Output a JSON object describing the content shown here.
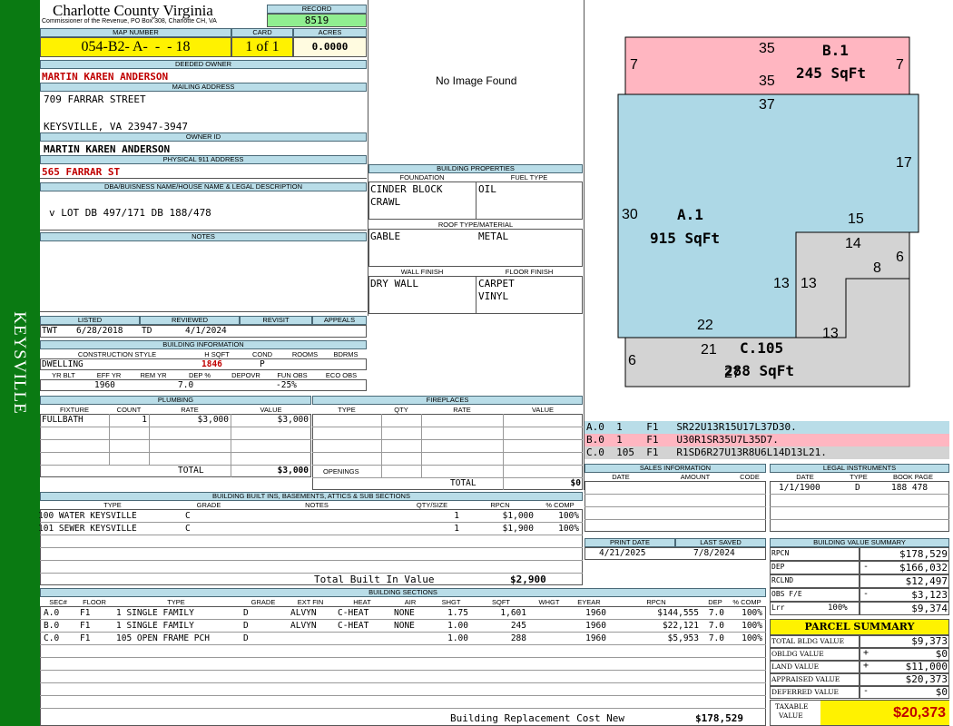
{
  "sidebar": {
    "label": "KEYSVILLE"
  },
  "county": {
    "title": "Charlotte County Virginia",
    "subtitle": "Commissioner of the Revenue, PO Box 308, Charlotte CH, VA"
  },
  "record": {
    "label": "RECORD",
    "value": "8519"
  },
  "map": {
    "label": "MAP NUMBER",
    "value": "054-B2- A-  -  - 18",
    "card_label": "CARD",
    "card": "1 of 1",
    "acres_label": "ACRES",
    "acres": "0.0000"
  },
  "owner": {
    "deeded_label": "DEEDED OWNER",
    "deeded": "MARTIN KAREN ANDERSON",
    "mailing_label": "MAILING ADDRESS",
    "mail1": "709 FARRAR STREET",
    "mail2": "KEYSVILLE, VA 23947-3947",
    "owner_id_label": "OWNER ID",
    "owner_id": "MARTIN KAREN ANDERSON",
    "physical_label": "PHYSICAL 911 ADDRESS",
    "physical": "565 FARRAR ST"
  },
  "legal": {
    "label": "DBA/BUISNESS NAME/HOUSE NAME & LEGAL DESCRIPTION",
    "text": "v  LOT DB 497/171 DB 188/478"
  },
  "notes": {
    "label": "NOTES"
  },
  "image": {
    "text": "No Image Found"
  },
  "bprops": {
    "label": "BUILDING PROPERTIES",
    "foundation_label": "FOUNDATION",
    "fuel_label": "FUEL TYPE",
    "foundation1": "CINDER BLOCK",
    "foundation2": "CRAWL",
    "fuel": "OIL",
    "roof_label": "ROOF TYPE/MATERIAL",
    "roof_type": "GABLE",
    "roof_mat": "METAL",
    "wall_label": "WALL FINISH",
    "floor_label": "FLOOR FINISH",
    "wall": "DRY WALL",
    "floor1": "CARPET",
    "floor2": "VINYL"
  },
  "listed": {
    "listed_label": "LISTED",
    "reviewed_label": "REVIEWED",
    "revisit_label": "REVISIT",
    "appeals_label": "APPEALS",
    "listed_by": "TWT",
    "listed_date": "6/28/2018",
    "reviewed_by": "TD",
    "reviewed_date": "4/1/2024"
  },
  "binfo": {
    "label": "BUILDING INFORMATION",
    "style_label": "CONSTRUCTION STYLE",
    "hsqft_label": "H SQFT",
    "cond_label": "COND",
    "rooms_label": "ROOMS",
    "bdrms_label": "BDRMS",
    "style": "DWELLING",
    "hsqft": "1846",
    "cond": "P",
    "yrblt_label": "YR BLT",
    "effyr_label": "EFF YR",
    "remyr_label": "REM YR",
    "dep_label": "DEP %",
    "depovr_label": "DEPOVR",
    "funobs_label": "FUN OBS",
    "ecoobs_label": "ECO OBS",
    "effyr": "1960",
    "dep": "7.0",
    "funobs": "-25%"
  },
  "plumbing": {
    "label": "PLUMBING",
    "fixture_label": "FIXTURE",
    "count_label": "COUNT",
    "rate_label": "RATE",
    "value_label": "VALUE",
    "fixture": "FULLBATH",
    "count": "1",
    "rate": "$3,000",
    "value": "$3,000",
    "total_label": "TOTAL",
    "total": "$3,000"
  },
  "fireplaces": {
    "label": "FIREPLACES",
    "type_label": "TYPE",
    "qty_label": "QTY",
    "rate_label": "RATE",
    "value_label": "VALUE",
    "openings_label": "OPENINGS",
    "total_label": "TOTAL",
    "total": "$0"
  },
  "builtins": {
    "label": "BUILDING BUILT INS, BASEMENTS, ATTICS & SUB SECTIONS",
    "cols": [
      "TYPE",
      "GRADE",
      "NOTES",
      "QTY/SIZE",
      "RPCN",
      "% COMP"
    ],
    "rows": [
      [
        "100 WATER KEYSVILLE",
        "C",
        "",
        "1",
        "$1,000",
        "100%"
      ],
      [
        "101 SEWER KEYSVILLE",
        "C",
        "",
        "1",
        "$1,900",
        "100%"
      ]
    ],
    "total_label": "Total Built In Value",
    "total": "$2,900"
  },
  "sections": {
    "label": "BUILDING SECTIONS",
    "cols": [
      "SEC#",
      "FLOOR",
      "TYPE",
      "GRADE",
      "EXT FIN",
      "HEAT",
      "AIR",
      "SHGT",
      "SQFT",
      "WHGT",
      "EYEAR",
      "RPCN",
      "DEP",
      "% COMP"
    ],
    "rows": [
      [
        "A.0",
        "F1",
        "1 SINGLE FAMILY",
        "D",
        "ALVYN",
        "C-HEAT",
        "NONE",
        "1.75",
        "1,601",
        "",
        "1960",
        "$144,555",
        "7.0",
        "100%"
      ],
      [
        "B.0",
        "F1",
        "1 SINGLE FAMILY",
        "D",
        "ALVYN",
        "C-HEAT",
        "NONE",
        "1.00",
        "245",
        "",
        "1960",
        "$22,121",
        "7.0",
        "100%"
      ],
      [
        "C.0",
        "F1",
        "105 OPEN FRAME PCH",
        "D",
        "",
        "",
        "",
        "1.00",
        "288",
        "",
        "1960",
        "$5,953",
        "7.0",
        "100%"
      ]
    ],
    "brcn_label": "Building Replacement Cost New",
    "brcn": "$178,529"
  },
  "sketch": {
    "b_label": "B.1",
    "b_sqft": "245 SqFt",
    "a_label": "A.1",
    "a_sqft": "915 SqFt",
    "c_label": "C.105",
    "c_sqft": "288 SqFt",
    "dims": [
      "35",
      "35",
      "7",
      "7",
      "37",
      "17",
      "30",
      "15",
      "14",
      "6",
      "8",
      "13",
      "13",
      "13",
      "22",
      "21",
      "6",
      "27"
    ]
  },
  "vectors": [
    {
      "text": "A.0  1    F1   SR22U13R15U17L37D30."
    },
    {
      "text": "B.0  1    F1   U30R1SR35U7L35D7."
    },
    {
      "text": "C.0  105  F1   R1SD6R27U13R8U6L14D13L21."
    }
  ],
  "sales": {
    "label": "SALES INFORMATION",
    "date_label": "DATE",
    "amount_label": "AMOUNT",
    "code_label": "CODE"
  },
  "legalinst": {
    "label": "LEGAL INSTRUMENTS",
    "date_label": "DATE",
    "type_label": "TYPE",
    "book_label": "BOOK PAGE",
    "date": "1/1/1900",
    "type": "D",
    "book": "188 478"
  },
  "print": {
    "print_label": "PRINT DATE",
    "saved_label": "LAST SAVED",
    "print_date": "4/21/2025",
    "saved": "7/8/2024"
  },
  "bvs": {
    "label": "BUILDING VALUE SUMMARY",
    "rows": [
      {
        "label": "RPCN",
        "sign": "",
        "value": "$178,529"
      },
      {
        "label": "DEP",
        "sign": "-",
        "value": "$166,032"
      },
      {
        "label": "RCLND",
        "sign": "",
        "value": "$12,497"
      },
      {
        "label": "OBS F/E",
        "sign": "-",
        "value": "$3,123"
      },
      {
        "label": "Lrr",
        "pct": "100%",
        "sign": "",
        "value": "$9,374"
      }
    ]
  },
  "parcel": {
    "label": "PARCEL SUMMARY",
    "rows": [
      {
        "label": "TOTAL BLDG VALUE",
        "sign": "",
        "value": "$9,373"
      },
      {
        "label": "OBLDG VALUE",
        "sign": "+",
        "value": "$0"
      },
      {
        "label": "LAND VALUE",
        "sign": "+",
        "value": "$11,000"
      },
      {
        "label": "APPRAISED VALUE",
        "sign": "",
        "value": "$20,373"
      },
      {
        "label": "DEFERRED VALUE",
        "sign": "-",
        "value": "$0"
      }
    ],
    "taxable_label1": "TAXABLE",
    "taxable_label2": "VALUE",
    "taxable": "$20,373"
  },
  "colors": {
    "green": "#0a7a12",
    "yellow": "#fff200",
    "pink": "#ffb6c1",
    "blue": "#add8e6",
    "gray": "#d3d3d3",
    "red": "#c00000"
  }
}
